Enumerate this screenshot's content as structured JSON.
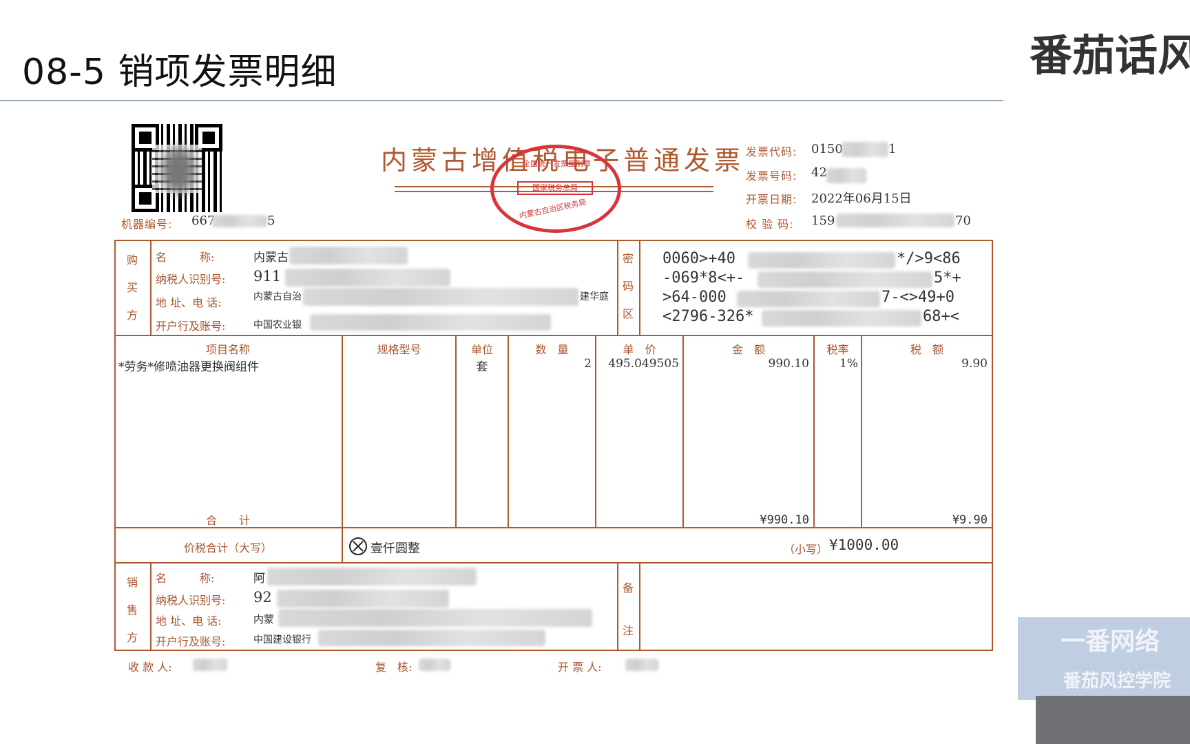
{
  "slide": {
    "title": "08-5 销项发票明细",
    "brand": "番茄话风"
  },
  "watermark": {
    "line1": "一番网络",
    "line2": "番茄风控学院"
  },
  "invoice": {
    "title": "内蒙古增值税电子普通发票",
    "seal": {
      "top": "全国统一发票监制章",
      "middle": "国家税务总局",
      "bottom": "内蒙古自治区税务局"
    },
    "meta": {
      "code_label": "发票代码:",
      "code_value": "0150",
      "code_suffix": "1",
      "number_label": "发票号码:",
      "number_value": "42",
      "date_label": "开票日期:",
      "date_value": "2022年06月15日",
      "check_label": "校 验 码:",
      "check_value": "159",
      "check_suffix": "70",
      "machine_label": "机器编号:",
      "machine_value": "667",
      "machine_suffix": "5"
    },
    "buyer": {
      "side_label": [
        "购",
        "买",
        "方"
      ],
      "name_label": "名　　　称:",
      "name_value": "内蒙古",
      "tax_label": "纳税人识别号:",
      "tax_value": "911",
      "addr_label": "地 址、电 话:",
      "addr_value": "内蒙古自治",
      "addr_tail": "建华庭",
      "bank_label": "开户行及账号:",
      "bank_value": "中国农业银"
    },
    "cipher": {
      "side_label": [
        "密",
        "码",
        "区"
      ],
      "lines": [
        "0060>+40",
        "-069*8<+-",
        ">64-000",
        "<2796-326*"
      ],
      "tails": [
        "*/>9<86",
        "5*+",
        "7-<>49+0",
        "68+<"
      ]
    },
    "items": {
      "headers": [
        "项目名称",
        "规格型号",
        "单位",
        "数　量",
        "单　价",
        "金　额",
        "税率",
        "税　额"
      ],
      "rows": [
        {
          "name": "*劳务*修喷油器更换阀组件",
          "spec": "",
          "unit": "套",
          "qty": "2",
          "price": "495.049505",
          "amount": "990.10",
          "rate": "1%",
          "tax": "9.90"
        }
      ],
      "total_label": "合　　计",
      "total_amount": "¥990.10",
      "total_tax": "¥9.90"
    },
    "grand_total": {
      "label": "价税合计（大写）",
      "uppercase": "壹仟圆整",
      "lowercase_label": "（小写）",
      "lowercase_value": "¥1000.00"
    },
    "seller": {
      "side_label": [
        "销",
        "售",
        "方"
      ],
      "name_label": "名　　　称:",
      "name_value": "阿",
      "tax_label": "纳税人识别号:",
      "tax_value": "92",
      "addr_label": "地 址、电 话:",
      "addr_value": "内蒙",
      "bank_label": "开户行及账号:",
      "bank_value": "中国建设银行"
    },
    "remarks": {
      "side_label": [
        "备",
        "注"
      ]
    },
    "footer": {
      "payee_label": "收 款 人:",
      "reviewer_label": "复　核:",
      "drawer_label": "开 票 人:"
    }
  }
}
